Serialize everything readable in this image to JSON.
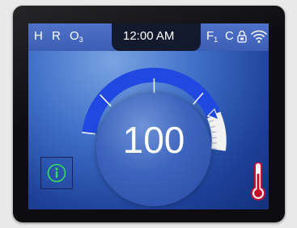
{
  "status_bar": {
    "h_label": "H",
    "r_label": "R",
    "o_label": "O",
    "o_sub": "3",
    "time": "12:00 AM",
    "f_label": "F",
    "f_sub": "1",
    "c_label": "C"
  },
  "setpoint": {
    "value": "100"
  },
  "gauge": {
    "level": 0.78,
    "active_color": "#1f49e0",
    "segment_count": 4
  },
  "icons": {
    "lock": "lock-icon",
    "wifi": "wifi-icon",
    "info": "info-icon",
    "thermometer": "thermometer-icon",
    "next": "play-right-icon"
  },
  "colors": {
    "screen_blue": "#3f6fc8",
    "info_green": "#2ee05a",
    "thermo_red": "#c4102c"
  }
}
